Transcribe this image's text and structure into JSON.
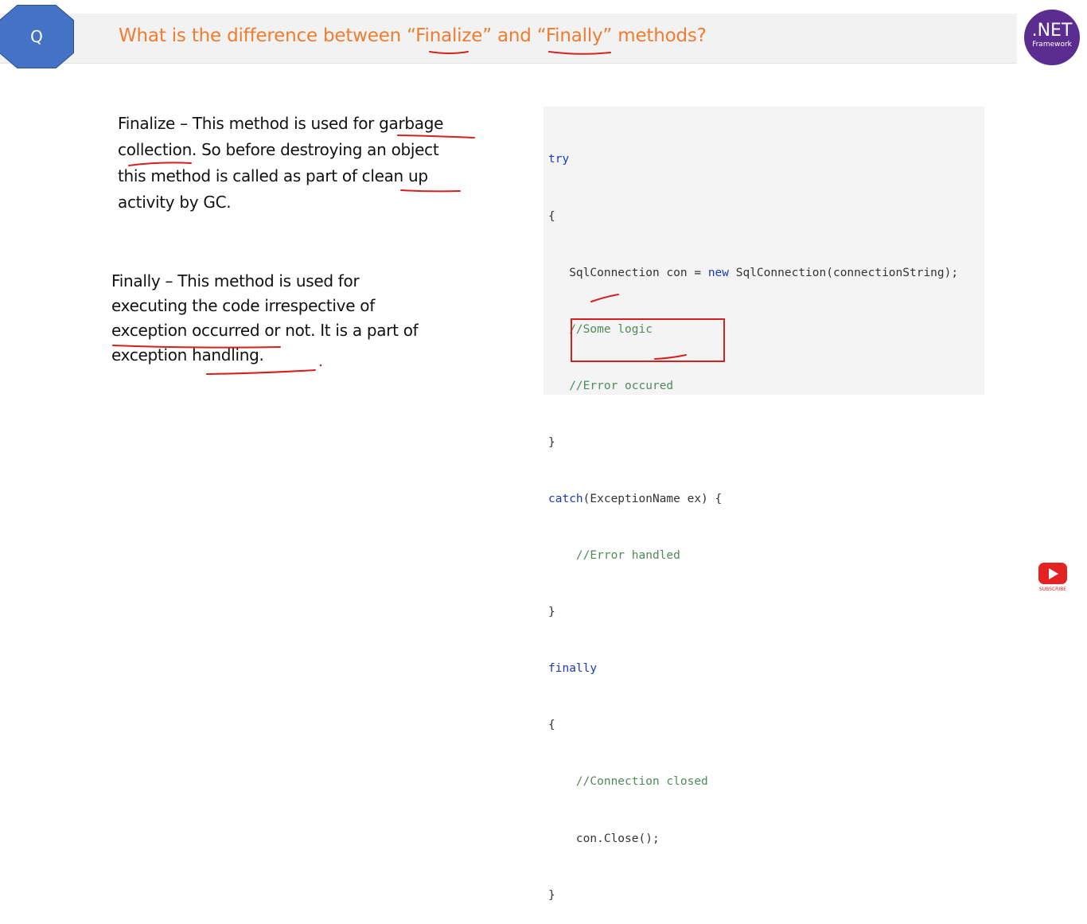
{
  "header": {
    "badge": "Q",
    "title": "What is the difference between “Finalize” and “Finally” methods?"
  },
  "logo": {
    "main": ".NET",
    "sub": "Framework"
  },
  "finalize_block": {
    "lines": [
      "Finalize – This method is used for garbage",
      "collection. So before destroying an object",
      "this method is called as part of clean up",
      "activity by GC."
    ]
  },
  "finally_block": {
    "lines": [
      "Finally – This method is used for",
      "executing the code irrespective of",
      "exception occurred or not. It is a part of",
      "exception handling."
    ]
  },
  "code": {
    "try_kw": "try",
    "open1": "{",
    "stmt_prefix": "SqlConnection con = ",
    "new_kw": "new",
    "stmt_suffix": " SqlConnection(connectionString);",
    "comment_logic": "//Some logic",
    "comment_error": "//Error occured",
    "close1": "}",
    "catch_kw": "catch",
    "catch_rest": "(ExceptionName ex) {",
    "comment_handled": "//Error handled",
    "close2": "}",
    "finally_kw": "finally",
    "open3": "{",
    "comment_closed": "//Connection closed",
    "close_call": "con.Close();",
    "close3": "}"
  },
  "subscribe": {
    "label": "SUBSCRIBE"
  },
  "colors": {
    "title": "#ed7d31",
    "badge": "#4472c4",
    "logo": "#5c2d91",
    "keyword": "#1a3ab7",
    "comment": "#4f8a5b",
    "annotation": "#d62020"
  }
}
